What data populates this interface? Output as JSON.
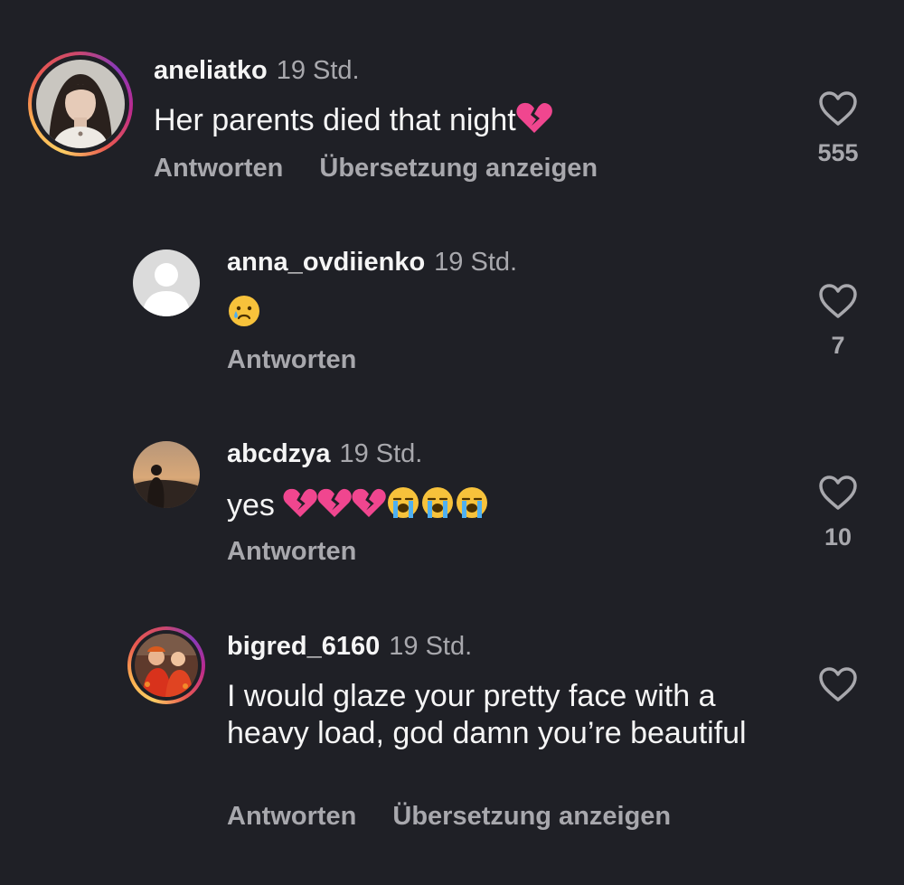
{
  "comments": [
    {
      "username": "aneliatko",
      "time": "19 Std.",
      "text": "Her parents died that night",
      "emojis": [
        "broken-heart"
      ],
      "reply_label": "Antworten",
      "translate_label": "Übersetzung anzeigen",
      "likes": "555",
      "has_story_ring": true
    },
    {
      "username": "anna_ovdiienko",
      "time": "19 Std.",
      "text": "",
      "emojis": [
        "crying-face"
      ],
      "reply_label": "Antworten",
      "likes": "7",
      "has_story_ring": false
    },
    {
      "username": "abcdzya",
      "time": "19 Std.",
      "text": "yes ",
      "emojis": [
        "broken-heart",
        "broken-heart",
        "broken-heart",
        "loudly-crying-face",
        "loudly-crying-face",
        "loudly-crying-face"
      ],
      "reply_label": "Antworten",
      "likes": "10",
      "has_story_ring": false
    },
    {
      "username": "bigred_6160",
      "time": "19 Std.",
      "text": "I would glaze your pretty face with a heavy load, god damn you’re beautiful",
      "emojis": [],
      "reply_label": "Antworten",
      "translate_label": "Übersetzung anzeigen",
      "likes": "",
      "has_story_ring": true
    }
  ],
  "colors": {
    "background": "#1f2026",
    "primary_text": "#f5f5f5",
    "secondary_text": "#a8a8ad",
    "broken_heart": "#f0468f"
  },
  "icons": {
    "like": "heart-outline-icon",
    "broken_heart": "broken-heart-emoji",
    "crying": "crying-face-emoji",
    "loudly_crying": "loudly-crying-face-emoji"
  }
}
